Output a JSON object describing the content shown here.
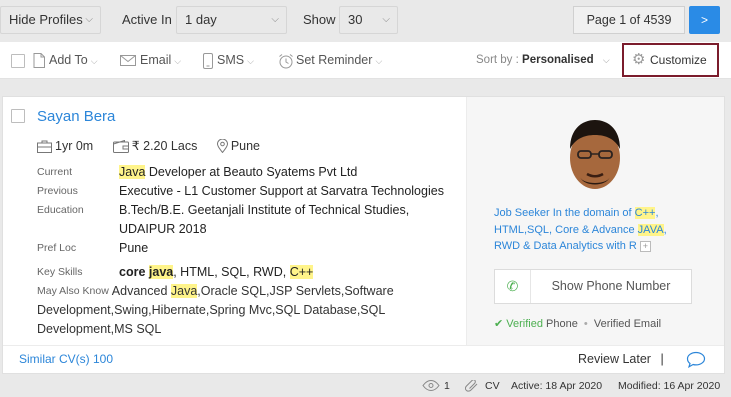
{
  "filters": {
    "profiles": "Hide Profiles",
    "active_in_label": "Active In",
    "active_in_value": "1 day",
    "show_label": "Show",
    "show_value": "30",
    "page_info": "Page 1 of 4539",
    "next_label": ">"
  },
  "actions": {
    "add_to": "Add To",
    "email": "Email",
    "sms": "SMS",
    "set_reminder": "Set Reminder",
    "sort_label": "Sort by :",
    "sort_value": "Personalised",
    "customize": "Customize"
  },
  "candidate": {
    "name": "Sayan Bera",
    "experience": "1yr 0m",
    "salary": "₹ 2.20 Lacs",
    "location": "Pune",
    "labels": {
      "current": "Current",
      "previous": "Previous",
      "education": "Education",
      "pref_loc": "Pref Loc",
      "key_skills": "Key Skills",
      "may_also_know": "May Also Know"
    },
    "current_hl": "Java",
    "current_rest": " Developer at Beauto Syatems Pvt Ltd",
    "previous": "Executive - L1 Customer Support at Sarvatra Technologies",
    "education_1": "B.Tech/B.E. Geetanjali Institute of Technical Studies,",
    "education_2": "UDAIPUR 2018",
    "pref_loc": "Pune",
    "skills_core": "core ",
    "skills_java": "java",
    "skills_mid": ", HTML, SQL, RWD, ",
    "skills_cpp": "C++",
    "may_pre": "Advanced ",
    "may_java": "Java",
    "may_rest_1": ",Oracle SQL,JSP Servlets,Software",
    "may_rest_2": "Development,Swing,Hibernate,Spring Mvc,SQL Database,SQL",
    "may_rest_3": "Development,MS SQL",
    "summary_1": "Job Seeker In the domain of ",
    "summary_cpp": "C++",
    "summary_2": ",",
    "summary_3": "HTML,SQL, Core & Advance ",
    "summary_java": "JAVA",
    "summary_4": ",",
    "summary_5": "RWD & Data Analytics with R",
    "summary_plus": "+",
    "show_phone": "Show Phone Number",
    "verified_word": "Verified",
    "phone_word": "Phone",
    "verified_email": "Verified Email"
  },
  "footer": {
    "similar": "Similar CV(s) 100",
    "review_later": "Review Later",
    "separator": "|"
  },
  "status": {
    "views": "1",
    "cv": "CV",
    "active": "Active: 18 Apr 2020",
    "modified": "Modified: 16 Apr 2020"
  }
}
